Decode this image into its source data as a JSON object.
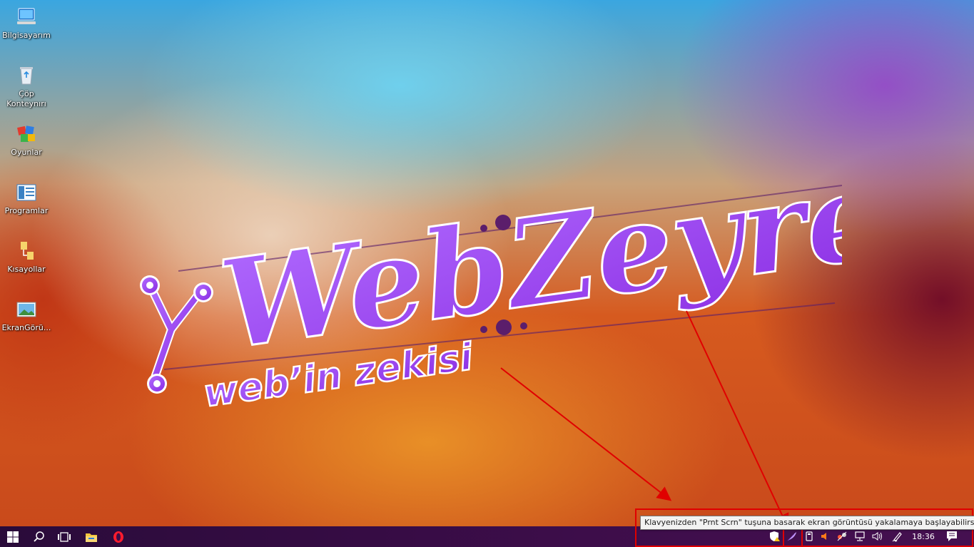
{
  "desktop": {
    "icons": [
      {
        "label": "Bilgisayarım",
        "icon": "computer-icon"
      },
      {
        "label": "Çöp Konteynırı",
        "icon": "recycle-bin-icon"
      },
      {
        "label": "Oyunlar",
        "icon": "games-folder-icon"
      },
      {
        "label": "Programlar",
        "icon": "programs-folder-icon"
      },
      {
        "label": "Kısayollar",
        "icon": "shortcuts-folder-icon"
      },
      {
        "label": "EkranGörü...",
        "icon": "image-file-icon"
      }
    ]
  },
  "wallpaper": {
    "brand": "WebZeyrek",
    "tagline": "web’in zekisi",
    "brand_color": "#9b3ff0"
  },
  "taskbar": {
    "pinned": [
      {
        "icon": "windows-start-icon"
      },
      {
        "icon": "search-icon"
      },
      {
        "icon": "task-view-icon"
      },
      {
        "icon": "file-explorer-icon"
      },
      {
        "icon": "opera-browser-icon"
      }
    ],
    "tray_icons": [
      "security-shield-icon",
      "feather-capture-icon",
      "usb-device-icon",
      "warning-speaker-icon",
      "network-activity-icon",
      "network-icon",
      "volume-icon",
      "pen-icon"
    ],
    "clock": "18:36",
    "notification_icon": "action-center-icon"
  },
  "tooltip": {
    "text": "Klavyenizden \"Prnt Scrn\" tuşuna basarak ekran görüntüsü yakalamaya başlayabilirsiniz."
  },
  "annotation_color": "#e00000"
}
